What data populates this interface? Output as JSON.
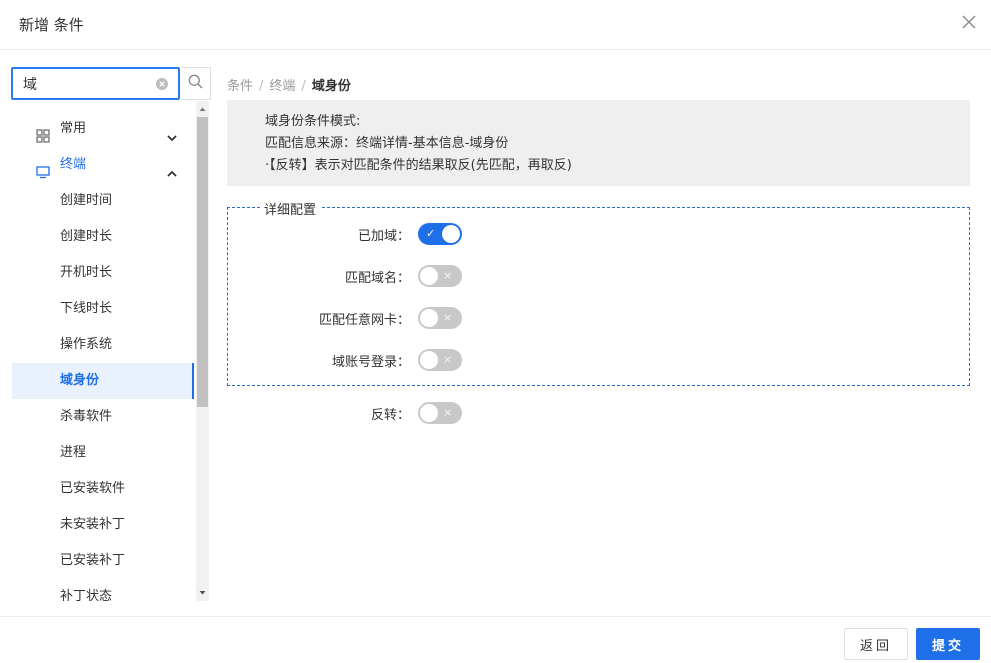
{
  "dialog": {
    "title": "新增 条件"
  },
  "search": {
    "value": "域"
  },
  "tree": {
    "group_common": "常用",
    "group_terminal": "终端",
    "items": [
      "创建时间",
      "创建时长",
      "开机时长",
      "下线时长",
      "操作系统",
      "域身份",
      "杀毒软件",
      "进程",
      "已安装软件",
      "未安装补丁",
      "已安装补丁",
      "补丁状态"
    ],
    "active_item": "域身份"
  },
  "breadcrumb": {
    "items": [
      "条件",
      "终端",
      "域身份"
    ]
  },
  "description": {
    "line1": "域身份条件模式:",
    "line2": "匹配信息来源：终端详情-基本信息-域身份",
    "line3": "·【反转】表示对匹配条件的结果取反(先匹配，再取反)"
  },
  "detail": {
    "legend": "详细配置",
    "rows": [
      {
        "label": "已加域：",
        "on": true
      },
      {
        "label": "匹配域名：",
        "on": false
      },
      {
        "label": "匹配任意网卡：",
        "on": false
      },
      {
        "label": "域账号登录：",
        "on": false
      }
    ]
  },
  "reverse": {
    "label": "反转：",
    "on": false
  },
  "switch_marks": {
    "on": "✓",
    "off": "×"
  },
  "footer": {
    "back_label": "返回",
    "submit_label": "提交"
  },
  "colors": {
    "accent": "#1e6fe8",
    "switch_off": "#c8c8c8",
    "desc_bg": "#efefef"
  }
}
